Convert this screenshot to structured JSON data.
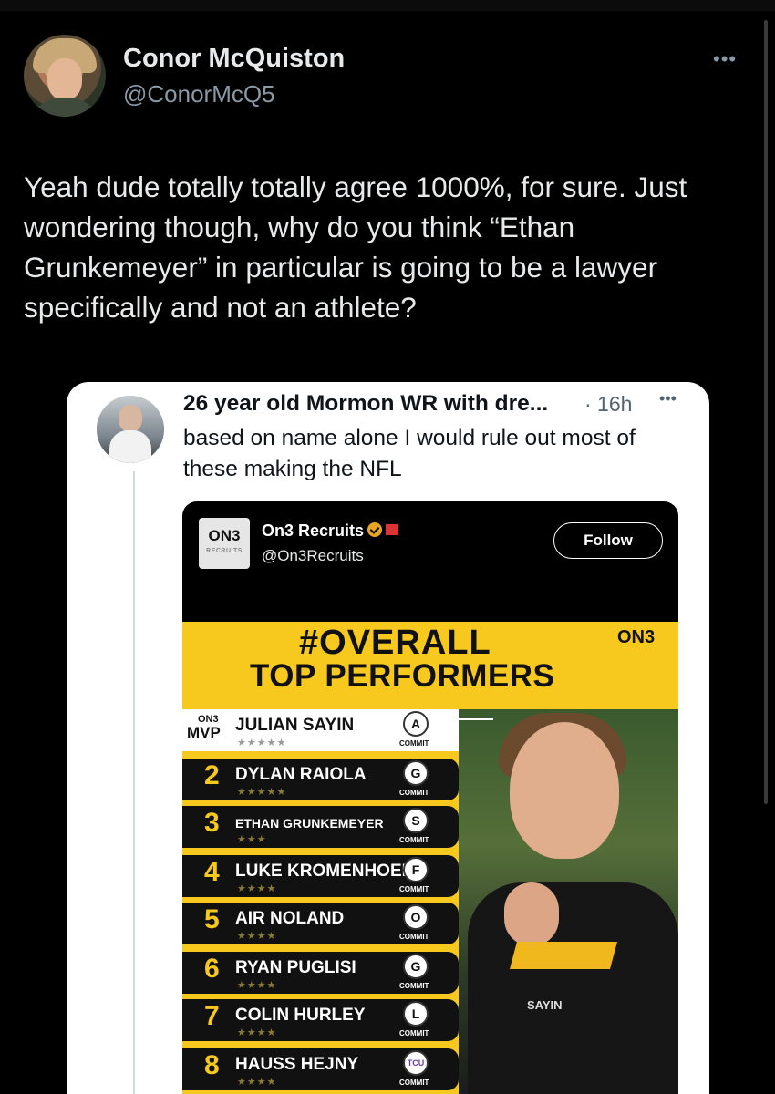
{
  "tweet": {
    "author_name": "Conor McQuiston",
    "author_handle": "@ConorMcQ5",
    "more_icon": "more-dots-icon",
    "text": "Yeah dude totally totally agree 1000%, for sure. Just wondering though, why do you think “Ethan Grunkemeyer” in particular is going to be a lawyer specifically and not an athlete?"
  },
  "quoted": {
    "author_name": "26 year old Mormon WR with dre...",
    "time": "· 16h",
    "text": "based on name alone I would rule out most of these making the NFL"
  },
  "embedded": {
    "logo_text": "ON3",
    "logo_sub": "RECRUITS",
    "name": "On3 Recruits",
    "handle": "@On3Recruits",
    "follow_label": "Follow",
    "graphic": {
      "headline": "#OVERALL",
      "subhead": "TOP PERFORMERS",
      "brand": "ON3",
      "photo_jersey": "SAYIN",
      "mvp_brand": "ON3",
      "mvp_label": "MVP",
      "players": [
        {
          "rank": "",
          "name": "JULIAN SAYIN",
          "stars": "★★★★★",
          "logo": "A",
          "status": "COMMIT"
        },
        {
          "rank": "2",
          "name": "DYLAN RAIOLA",
          "stars": "★★★★★",
          "logo": "G",
          "status": "COMMIT"
        },
        {
          "rank": "3",
          "name": "ETHAN GRUNKEMEYER",
          "stars": "★★★",
          "logo": "S",
          "status": "COMMIT"
        },
        {
          "rank": "4",
          "name": "LUKE KROMENHOEK",
          "stars": "★★★★",
          "logo": "F",
          "status": "COMMIT"
        },
        {
          "rank": "5",
          "name": "AIR NOLAND",
          "stars": "★★★★",
          "logo": "O",
          "status": "COMMIT"
        },
        {
          "rank": "6",
          "name": "RYAN PUGLISI",
          "stars": "★★★★",
          "logo": "G",
          "status": "COMMIT"
        },
        {
          "rank": "7",
          "name": "COLIN HURLEY",
          "stars": "★★★★",
          "logo": "L",
          "status": "COMMIT"
        },
        {
          "rank": "8",
          "name": "HAUSS HEJNY",
          "stars": "★★★★",
          "logo": "TCU",
          "status": "COMMIT"
        }
      ]
    }
  },
  "colors": {
    "background": "#000000",
    "accent_yellow": "#f7c81e",
    "verified_gold": "#e8a524"
  }
}
